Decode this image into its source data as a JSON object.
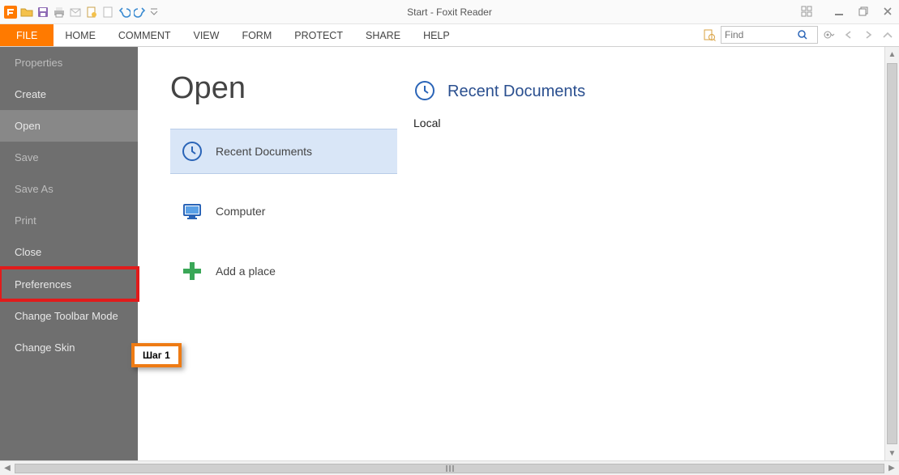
{
  "window": {
    "title": "Start - Foxit Reader"
  },
  "qat_icons": [
    "foxit-logo",
    "open-icon",
    "save-icon",
    "print-icon",
    "email-icon",
    "new-file-icon",
    "blank-page-icon",
    "undo-icon",
    "redo-icon",
    "qat-dropdown-icon"
  ],
  "winctrls": [
    "ribbon-collapse-icon",
    "minimize-icon",
    "restore-icon",
    "close-icon"
  ],
  "ribbon": {
    "tabs": [
      {
        "label": "FILE",
        "key": "file"
      },
      {
        "label": "HOME"
      },
      {
        "label": "COMMENT"
      },
      {
        "label": "VIEW"
      },
      {
        "label": "FORM"
      },
      {
        "label": "PROTECT"
      },
      {
        "label": "SHARE"
      },
      {
        "label": "HELP"
      }
    ],
    "search": {
      "placeholder": "Find"
    },
    "right_icons": [
      "find-file-icon",
      "search-go-icon",
      "gear-dropdown-icon",
      "nav-prev-icon",
      "nav-next-icon",
      "nav-up-icon"
    ]
  },
  "filemenu": {
    "items": [
      {
        "label": "Properties",
        "state": "disabled"
      },
      {
        "label": "Create"
      },
      {
        "label": "Open",
        "state": "selected"
      },
      {
        "label": "Save",
        "state": "disabled"
      },
      {
        "label": "Save As",
        "state": "disabled"
      },
      {
        "label": "Print",
        "state": "disabled"
      },
      {
        "label": "Close"
      },
      {
        "label": "Preferences",
        "state": "highlighted",
        "sep": true
      },
      {
        "label": "Change Toolbar Mode"
      },
      {
        "label": "Change Skin"
      }
    ]
  },
  "callout": {
    "label": "Шаг 1"
  },
  "backstage": {
    "title": "Open",
    "locations": [
      {
        "label": "Recent Documents",
        "icon": "clock-icon",
        "state": "selected"
      },
      {
        "label": "Computer",
        "icon": "monitor-icon"
      },
      {
        "label": "Add a place",
        "icon": "plus-icon"
      }
    ],
    "detail": {
      "heading": "Recent Documents",
      "icon": "clock-icon",
      "section_label": "Local"
    }
  }
}
